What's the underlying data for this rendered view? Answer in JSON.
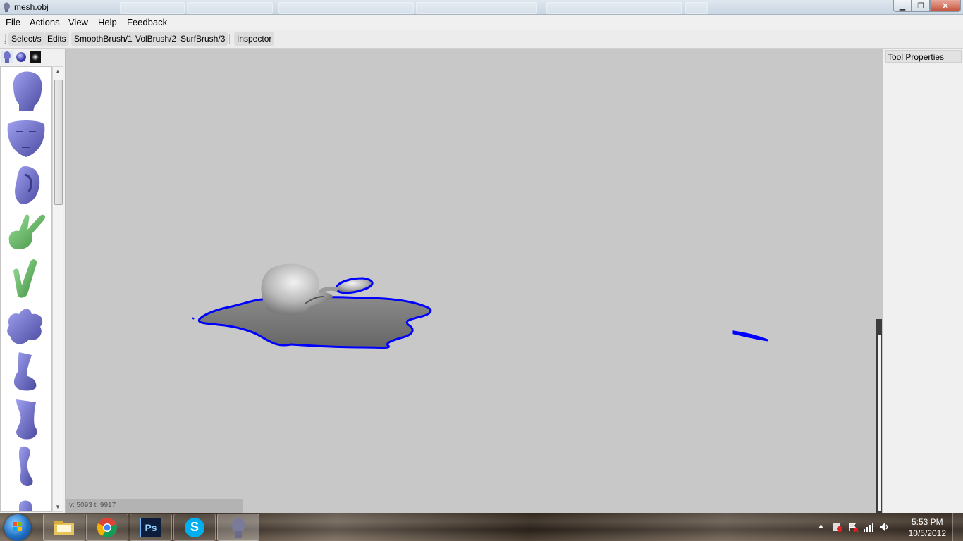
{
  "window": {
    "title": "mesh.obj",
    "controls": {
      "minimize": "▁",
      "maximize": "❐",
      "close": "✕"
    }
  },
  "menu": [
    "File",
    "Actions",
    "View",
    "Help",
    "Feedback"
  ],
  "toolbar": {
    "buttons": [
      "Select/s",
      "Edits",
      "SmoothBrush/1",
      "VolBrush/2",
      "SurfBrush/3"
    ],
    "inspector": "Inspector"
  },
  "left_panel": {
    "tabs": [
      "mesh-tab-icon",
      "sphere-tab-icon",
      "texture-tab-icon"
    ],
    "mesh_library": [
      {
        "name": "head-mesh-icon",
        "color": "#7272c8"
      },
      {
        "name": "face-mesh-icon",
        "color": "#7272c8"
      },
      {
        "name": "ear-mesh-icon",
        "color": "#7272c8"
      },
      {
        "name": "bunny-mesh-icon",
        "color": "#6ab86a"
      },
      {
        "name": "ears-mesh-icon",
        "color": "#5aa85a"
      },
      {
        "name": "blob-mesh-icon",
        "color": "#7272c8"
      },
      {
        "name": "foot-mesh-icon",
        "color": "#7272c8"
      },
      {
        "name": "leg-mesh-icon",
        "color": "#7272c8"
      },
      {
        "name": "ankle-mesh-icon",
        "color": "#7272c8"
      },
      {
        "name": "partial-mesh-icon",
        "color": "#7272c8"
      }
    ]
  },
  "viewport": {
    "status": "v: 5093  t: 9917",
    "selection_color": "#0000ff",
    "background": "#c8c8c8"
  },
  "right_panel": {
    "title": "Tool Properties"
  },
  "taskbar": {
    "apps": [
      "explorer-app-icon",
      "chrome-app-icon",
      "photoshop-app-icon",
      "skype-app-icon",
      "meshmixer-app-icon"
    ],
    "photoshop_label": "Ps",
    "skype_label": "S",
    "clock_time": "5:53 PM",
    "clock_date": "10/5/2012",
    "tray_arrow": "▲"
  }
}
